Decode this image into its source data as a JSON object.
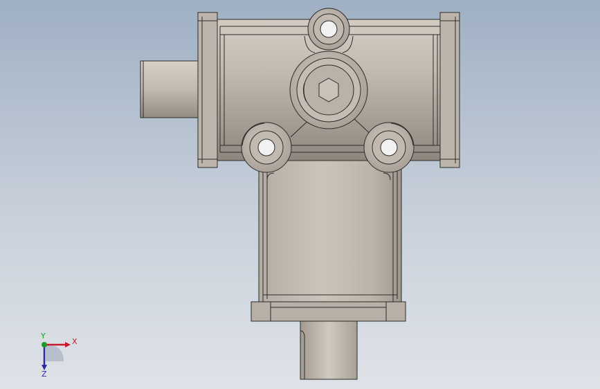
{
  "viewport": {
    "background_top": "#9fb0c4",
    "background_bottom": "#dfe3e8",
    "model_fill": "#bfb7ad",
    "model_edge": "#2a2a2a"
  },
  "triad": {
    "x_label": "X",
    "y_label": "Y",
    "z_label": "Z",
    "x_color": "#c8182a",
    "y_color": "#1a9a2a",
    "z_color": "#2a2aa8"
  }
}
